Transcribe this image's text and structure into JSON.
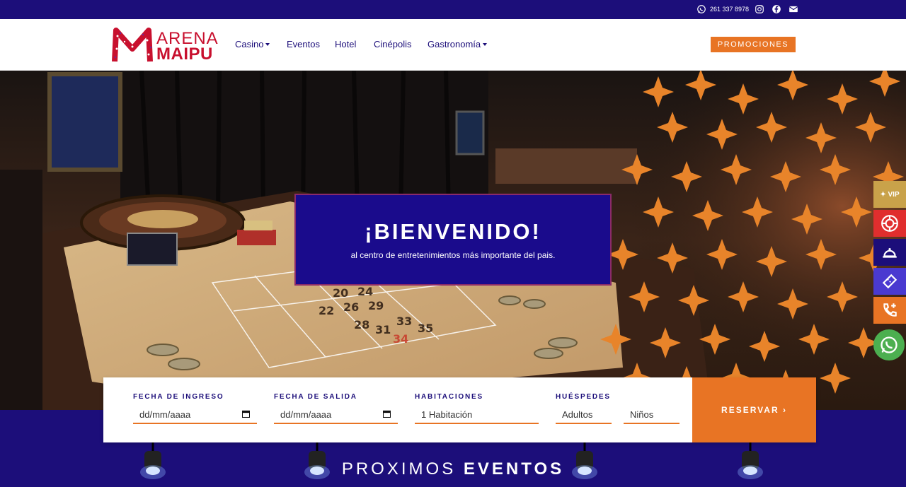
{
  "topbar": {
    "phone": "261 337 8978",
    "icons": [
      "whatsapp-icon",
      "instagram-icon",
      "facebook-icon",
      "mail-icon"
    ]
  },
  "header": {
    "logo_line1": "ARENA",
    "logo_line2": "MAIPU",
    "nav": [
      {
        "label": "Casino",
        "dropdown": true
      },
      {
        "label": "Eventos",
        "dropdown": false
      },
      {
        "label": "Hotel",
        "dropdown": false
      },
      {
        "label": "Cinépolis",
        "dropdown": false
      },
      {
        "label": "Gastronomía",
        "dropdown": true
      }
    ],
    "promo_label": "PROMOCIONES"
  },
  "hero": {
    "title": "¡BIENVENIDO!",
    "subtitle": "al centro de entretenimientos más importante del pais."
  },
  "side_buttons": {
    "vip_label": "VIP",
    "items": [
      "vip-icon",
      "roulette-icon",
      "concierge-bell-icon",
      "ticket-icon",
      "phone-icon",
      "whatsapp-icon"
    ]
  },
  "booking": {
    "checkin_label": "FECHA DE INGRESO",
    "checkin_placeholder": "dd/mm/aaaa",
    "checkout_label": "FECHA DE SALIDA",
    "checkout_placeholder": "dd/mm/aaaa",
    "rooms_label": "HABITACIONES",
    "rooms_value": "1 Habitación",
    "guests_label": "HUÉSPEDES",
    "adults_value": "Adultos",
    "children_value": "Niños",
    "submit_label": "RESERVAR ›"
  },
  "events": {
    "title_light": "PROXIMOS",
    "title_bold": "EVENTOS"
  },
  "colors": {
    "primary": "#1c0e7a",
    "accent": "#e87424",
    "logo_red": "#c8102e",
    "whatsapp": "#4caf50",
    "vip_gold": "#c9a24a",
    "side_red": "#e02e2e"
  }
}
